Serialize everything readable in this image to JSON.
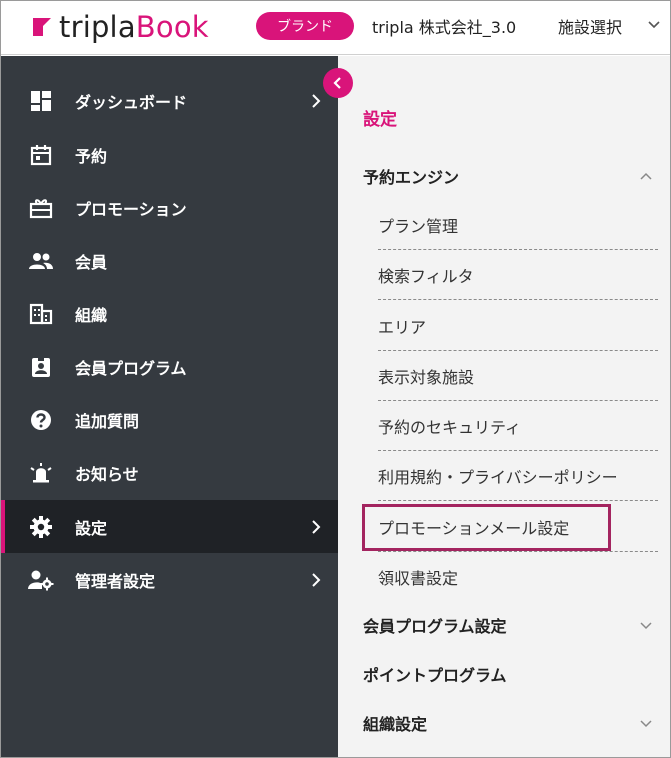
{
  "header": {
    "logo_part1": "tripla",
    "logo_part2": "Book",
    "brand_badge": "ブランド",
    "company": "tripla 株式会社_3.0",
    "facility_select": "施設選択",
    "facility_icon": "chevron-down-icon"
  },
  "sidebar": {
    "collapse_icon": "chevron-left-icon",
    "items": [
      {
        "label": "ダッシュボード",
        "icon": "dashboard-icon",
        "has_arrow": true
      },
      {
        "label": "予約",
        "icon": "calendar-icon",
        "has_arrow": false
      },
      {
        "label": "プロモーション",
        "icon": "gift-icon",
        "has_arrow": false
      },
      {
        "label": "会員",
        "icon": "people-icon",
        "has_arrow": false
      },
      {
        "label": "組織",
        "icon": "building-icon",
        "has_arrow": false
      },
      {
        "label": "会員プログラム",
        "icon": "badge-icon",
        "has_arrow": false
      },
      {
        "label": "追加質問",
        "icon": "question-icon",
        "has_arrow": false
      },
      {
        "label": "お知らせ",
        "icon": "alarm-icon",
        "has_arrow": false
      },
      {
        "label": "設定",
        "icon": "gear-icon",
        "has_arrow": true,
        "active": true
      },
      {
        "label": "管理者設定",
        "icon": "admin-settings-icon",
        "has_arrow": true
      }
    ]
  },
  "panel": {
    "title": "設定",
    "sections": [
      {
        "label": "予約エンジン",
        "expanded": true,
        "items": [
          "プラン管理",
          "検索フィルタ",
          "エリア",
          "表示対象施設",
          "予約のセキュリティ",
          "利用規約・プライバシーポリシー",
          "プロモーションメール設定",
          "領収書設定"
        ]
      },
      {
        "label": "会員プログラム設定",
        "expanded": false
      },
      {
        "label": "ポイントプログラム"
      },
      {
        "label": "組織設定",
        "expanded": false
      }
    ],
    "highlighted_item": "プロモーションメール設定"
  },
  "colors": {
    "accent": "#d9147a",
    "sidebar_bg": "#353a40",
    "sidebar_active_bg": "#1f2226",
    "panel_bg": "#f3f3f3",
    "highlight_border": "#a3245f"
  }
}
